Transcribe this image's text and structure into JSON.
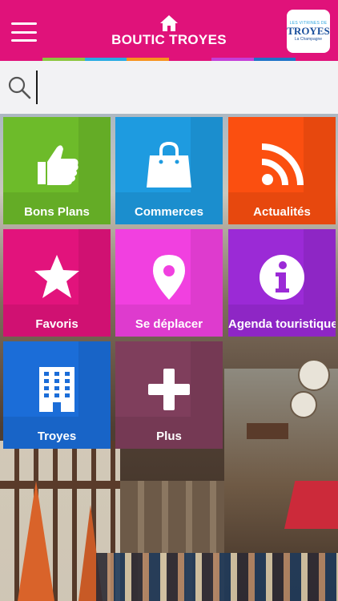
{
  "header": {
    "title": "BOUTIC TROYES",
    "background": "#e0127a",
    "logo": {
      "top": "LES VITRINES DE",
      "main": "TROYES",
      "sub": "La Champagne"
    }
  },
  "colorbar": [
    "#e0127a",
    "#8cc63f",
    "#29abe2",
    "#f7931e",
    "#e0127a",
    "#c43ed8",
    "#1e73c8",
    "#e0127a"
  ],
  "search": {
    "placeholder": "",
    "value": ""
  },
  "tiles": [
    {
      "label": "Bons Plans",
      "color": "#6dbb2a",
      "icon": "thumbs-up-icon"
    },
    {
      "label": "Commerces",
      "color": "#1e9be0",
      "icon": "shopping-bag-icon"
    },
    {
      "label": "Actualités",
      "color": "#fb4f10",
      "icon": "rss-icon"
    },
    {
      "label": "Favoris",
      "color": "#e2137c",
      "icon": "star-icon"
    },
    {
      "label": "Se déplacer",
      "color": "#f140e0",
      "icon": "map-pin-icon"
    },
    {
      "label": "Agenda touristique",
      "color": "#9b2ad6",
      "icon": "info-icon"
    },
    {
      "label": "Troyes",
      "color": "#1b6dd8",
      "icon": "building-icon"
    },
    {
      "label": "Plus",
      "color": "#7f3e5c",
      "icon": "plus-icon"
    }
  ]
}
